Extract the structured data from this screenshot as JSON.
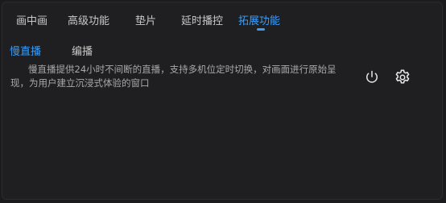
{
  "tabs": [
    {
      "label": "画中画",
      "active": false
    },
    {
      "label": "高级功能",
      "active": false
    },
    {
      "label": "垫片",
      "active": false
    },
    {
      "label": "延时播控",
      "active": false
    },
    {
      "label": "拓展功能",
      "active": true
    }
  ],
  "subtabs": [
    {
      "label": "慢直播",
      "active": true
    },
    {
      "label": "编播",
      "active": false
    }
  ],
  "feature": {
    "description": "慢直播提供24小时不间断的直播，支持多机位定时切换，对画面进行原始呈现，为用户建立沉浸式体验的窗口",
    "icons": [
      "power-icon",
      "gear-icon"
    ]
  },
  "colors": {
    "accent": "#3d9df5",
    "background": "#1f1f21",
    "text": "#c8c8c8",
    "muted_text": "#a9a9ab"
  }
}
